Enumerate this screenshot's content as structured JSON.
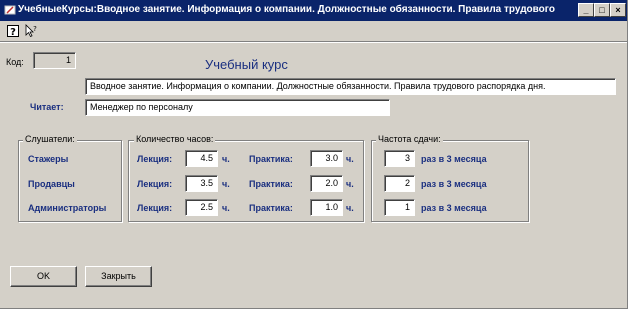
{
  "window": {
    "title": "УчебныеКурсы:Вводное занятие. Информация о компании. Должностные обязанности. Правила трудового распора...",
    "minimize": "_",
    "maximize": "□",
    "close": "×"
  },
  "form": {
    "code_label": "Код:",
    "code_value": "1",
    "heading": "Учебный курс",
    "course_name": "Вводное занятие. Информация о компании. Должностные обязанности. Правила трудового распорядка дня.",
    "reader_label": "Читает:",
    "reader_value": "Менеджер по персоналу"
  },
  "groups": {
    "listeners_title": "Слушатели:",
    "hours_title": "Количество часов:",
    "frequency_title": "Частота сдачи:"
  },
  "rows": [
    {
      "audience": "Стажеры",
      "lecture_label": "Лекция:",
      "lecture": "4.5",
      "lecture_unit": "ч.",
      "practice_label": "Практика:",
      "practice": "3.0",
      "practice_unit": "ч.",
      "frequency": "3",
      "frequency_unit": "раз в 3 месяца"
    },
    {
      "audience": "Продавцы",
      "lecture_label": "Лекция:",
      "lecture": "3.5",
      "lecture_unit": "ч.",
      "practice_label": "Практика:",
      "practice": "2.0",
      "practice_unit": "ч.",
      "frequency": "2",
      "frequency_unit": "раз в 3 месяца"
    },
    {
      "audience": "Администраторы",
      "lecture_label": "Лекция:",
      "lecture": "2.5",
      "lecture_unit": "ч.",
      "practice_label": "Практика:",
      "practice": "1.0",
      "practice_unit": "ч.",
      "frequency": "1",
      "frequency_unit": "раз в 3 месяца"
    }
  ],
  "buttons": {
    "ok": "OK",
    "close": "Закрыть"
  },
  "icons": {
    "app": "form-icon",
    "toolbar": [
      "help-icon",
      "whats-this-icon"
    ]
  }
}
